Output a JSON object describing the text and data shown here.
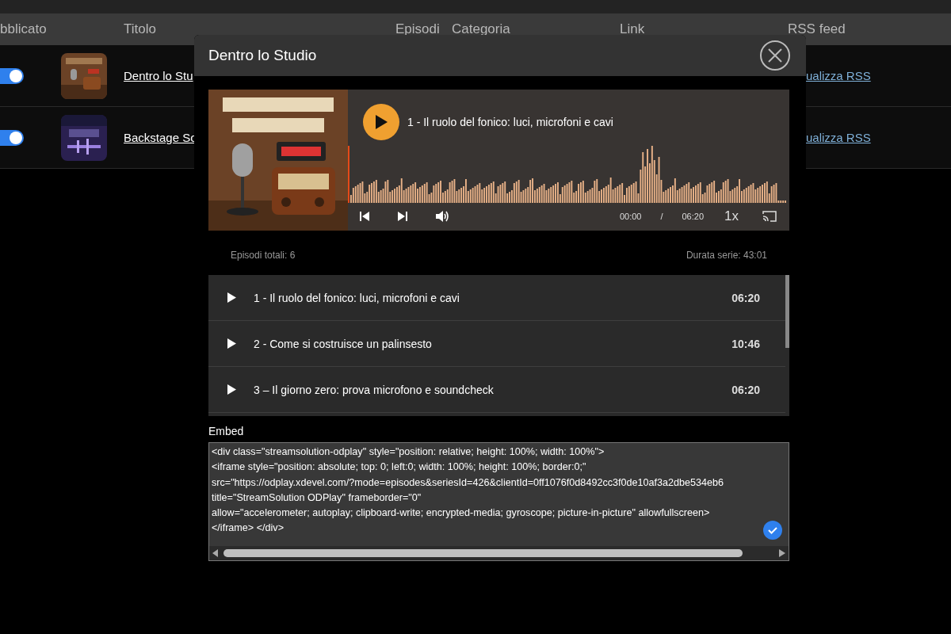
{
  "table": {
    "columns": [
      "bblicato",
      "Titolo",
      "Episodi",
      "Categoria",
      "Link",
      "RSS feed"
    ],
    "rows": [
      {
        "published": true,
        "title": "Dentro lo Stu",
        "rss": "ualizza RSS"
      },
      {
        "published": true,
        "title": "Backstage So",
        "rss": "ualizza RSS"
      }
    ]
  },
  "modal": {
    "title": "Dentro lo Studio",
    "player": {
      "now_playing": "1 - Il ruolo del fonico: luci, microfoni e cavi",
      "current_time": "00:00",
      "separator": "/",
      "duration": "06:20",
      "speed": "1x",
      "level": 0
    },
    "stats": {
      "total": "Episodi totali: 6",
      "length": "Durata serie: 43:01"
    },
    "episodes": [
      {
        "title": "1 - Il ruolo del fonico: luci, microfoni e cavi",
        "duration": "06:20"
      },
      {
        "title": "2 - Come si costruisce un palinsesto",
        "duration": "10:46"
      },
      {
        "title": "3 – Il giorno zero: prova microfono e soundcheck",
        "duration": "06:20"
      }
    ],
    "embed": {
      "label": "Embed",
      "value": "<div class=\"streamsolution-odplay\" style=\"position: relative; height: 100%; width: 100%\">\n<iframe style=\"position: absolute; top: 0; left:0; width: 100%; height: 100%; border:0;\"\nsrc=\"https://odplay.xdevel.com/?mode=episodes&seriesId=426&clientId=0ff1076f0d8492cc3f0de10af3a2dbe534eb6\ntitle=\"StreamSolution ODPlay\" frameborder=\"0\"\nallow=\"accelerometer; autoplay; clipboard-write; encrypted-media; gyroscope; picture-in-picture\" allowfullscreen>\n</iframe> </div>"
    }
  }
}
